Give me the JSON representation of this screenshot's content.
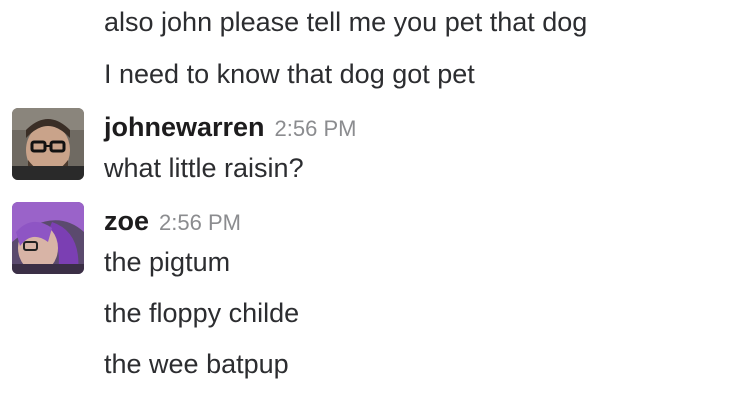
{
  "messages": [
    {
      "type": "continuation",
      "text": "also john please tell me you pet that dog"
    },
    {
      "type": "continuation",
      "text": "I need to know that dog got pet"
    },
    {
      "type": "group",
      "author": "johnewarren",
      "time": "2:56 PM",
      "avatar_icon": "user-photo-glasses-beard",
      "lines": [
        "what little raisin?"
      ]
    },
    {
      "type": "group",
      "author": "zoe",
      "time": "2:56 PM",
      "avatar_icon": "user-photo-purple-hair",
      "lines": [
        "the pigtum",
        "the floppy childe",
        "the wee batpup"
      ]
    }
  ]
}
